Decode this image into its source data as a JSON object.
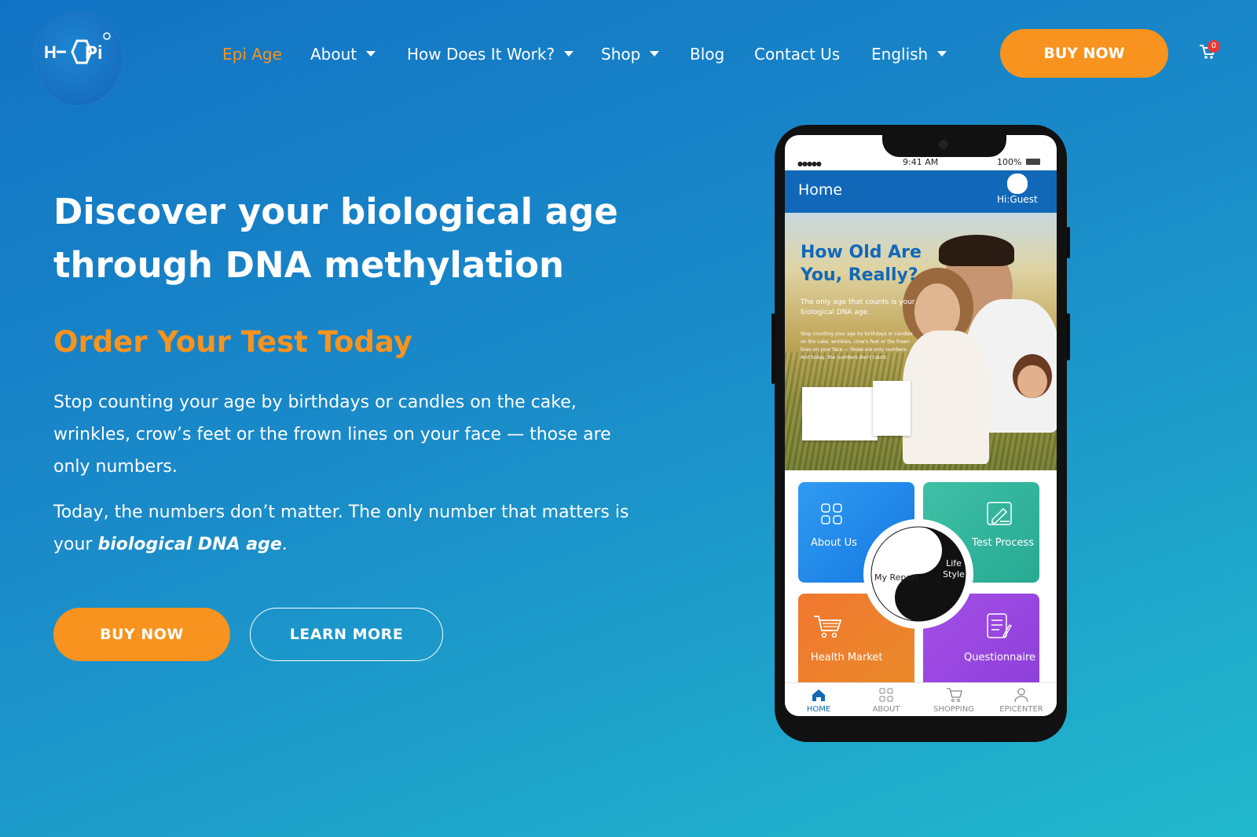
{
  "logo": {
    "text": "H-EPi",
    "icon": "dna-hexagon-logo"
  },
  "nav": {
    "items": [
      {
        "label": "Epi Age",
        "active": true,
        "dropdown": false
      },
      {
        "label": "About",
        "active": false,
        "dropdown": true
      },
      {
        "label": "How Does It Work?",
        "active": false,
        "dropdown": true
      },
      {
        "label": "Shop",
        "active": false,
        "dropdown": true
      },
      {
        "label": "Blog",
        "active": false,
        "dropdown": false
      },
      {
        "label": "Contact Us",
        "active": false,
        "dropdown": false
      },
      {
        "label": "English",
        "active": false,
        "dropdown": true
      }
    ],
    "buy_label": "BUY NOW",
    "cart_count": "0"
  },
  "hero": {
    "title": "Discover your biological age through DNA methylation",
    "subtitle": "Order Your Test Today",
    "para1": "Stop counting your age by birthdays or candles on the cake, wrinkles, crow’s feet or the frown lines on your face — those are only numbers.",
    "para2_pre": "Today, the numbers don’t matter. The only number that matters is your ",
    "para2_bold": "biological DNA age",
    "para2_post": ".",
    "buy_label": "BUY NOW",
    "learn_label": "LEARN MORE"
  },
  "phone": {
    "status": {
      "time": "9:41 AM",
      "battery": "100%"
    },
    "appbar": {
      "title": "Home",
      "guest": "Hi:Guest"
    },
    "banner": {
      "title": "How Old Are You, Really?",
      "sub": "The only age that counts is your biological DNA age.",
      "body": "Stop counting your age by birthdays or candles on the cake, wrinkles, crow's feet or the frown lines on your face — those are only numbers. And today, the numbers don't count."
    },
    "tiles": {
      "about": "About Us",
      "test": "Test Process",
      "market": "Health Market",
      "questionnaire": "Questionnaire"
    },
    "center": {
      "report": "My Report",
      "lifestyle": "Life Style"
    },
    "tabs": [
      {
        "label": "HOME",
        "icon": "home-icon",
        "active": true
      },
      {
        "label": "ABOUT",
        "icon": "grid-icon",
        "active": false
      },
      {
        "label": "SHOPPING",
        "icon": "cart-icon",
        "active": false
      },
      {
        "label": "EPICENTER",
        "icon": "user-icon",
        "active": false
      }
    ]
  },
  "colors": {
    "accent": "#f7931e",
    "brand": "#1268b8"
  }
}
